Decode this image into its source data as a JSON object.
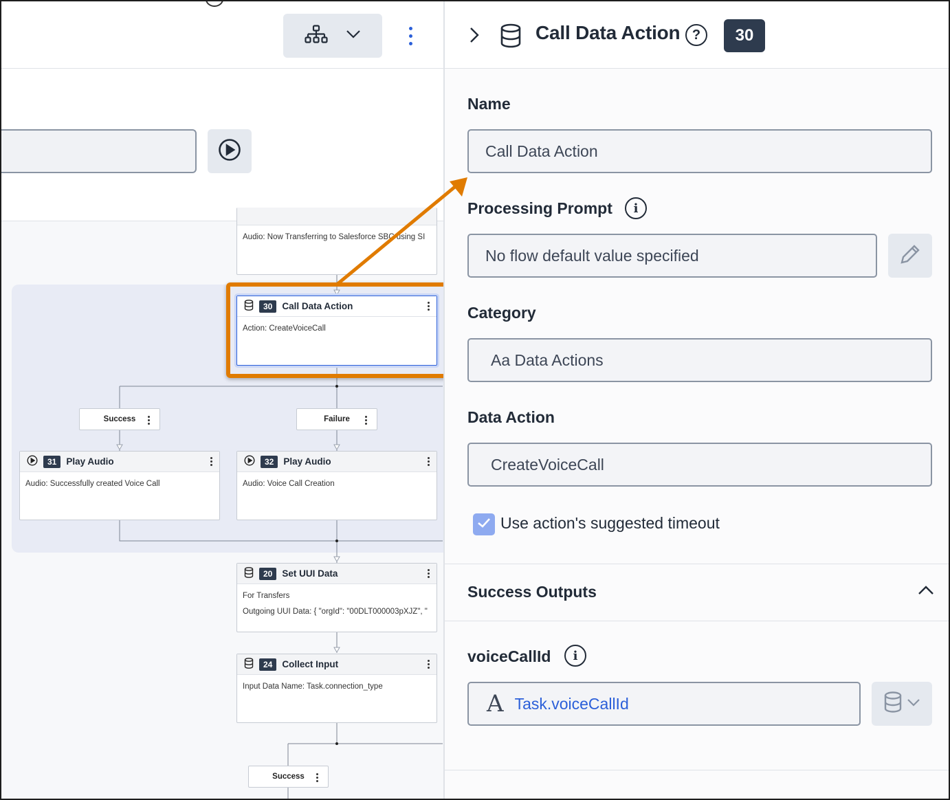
{
  "canvas": {
    "nodes": {
      "audio_transfer": {
        "body": "Audio: Now Transferring to Salesforce SBC using SI"
      },
      "call_data": {
        "num": "30",
        "title": "Call Data Action",
        "body": "Action: CreateVoiceCall"
      },
      "play_success": {
        "num": "31",
        "title": "Play Audio",
        "body": "Audio: Successfully created Voice Call"
      },
      "play_failure": {
        "num": "32",
        "title": "Play Audio",
        "body": "Audio: Voice Call Creation"
      },
      "set_uui": {
        "num": "20",
        "title": "Set UUI Data",
        "body1": "For Transfers",
        "body2": "Outgoing UUI Data: { \"orgId\": \"00DLT000003pXJZ\", \""
      },
      "collect_input": {
        "num": "24",
        "title": "Collect Input",
        "body": "Input Data Name: Task.connection_type"
      }
    },
    "pills": {
      "success": "Success",
      "failure": "Failure",
      "success2": "Success"
    }
  },
  "panel": {
    "title": "Call Data Action",
    "badge": "30",
    "name_label": "Name",
    "name_value": "Call Data Action",
    "prompt_label": "Processing Prompt",
    "prompt_value": "No flow default value specified",
    "category_label": "Category",
    "category_value": "Aa Data Actions",
    "data_action_label": "Data Action",
    "data_action_value": "CreateVoiceCall",
    "timeout_label": "Use action's suggested timeout",
    "timeout_checked": true,
    "success_outputs_label": "Success Outputs",
    "output_name": "voiceCallId",
    "output_value": "Task.voiceCallId"
  },
  "colors": {
    "accent": "#2b5fd9",
    "highlight": "#e07b00",
    "badge": "#2e3b4e"
  }
}
